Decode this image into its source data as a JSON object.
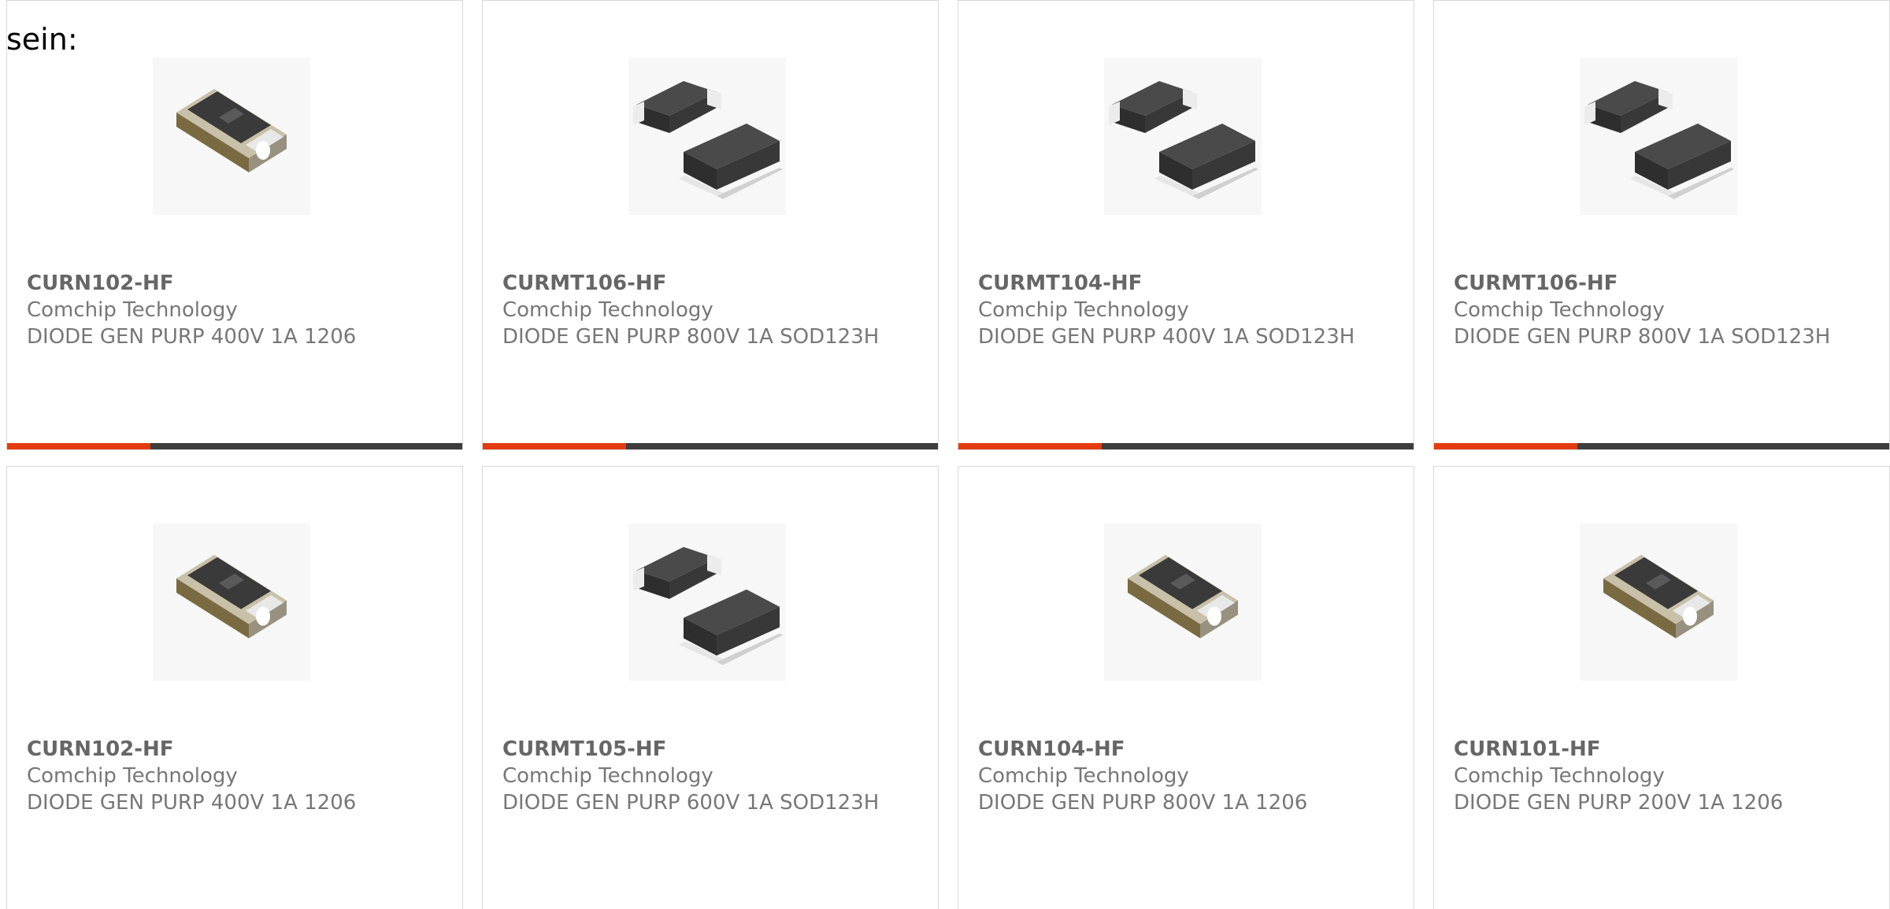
{
  "intro_text": "sein:",
  "colors": {
    "accent": "#e43b0f",
    "bar": "#3d3d3d",
    "border": "#d9d9d9",
    "text": "#777777"
  },
  "products": [
    {
      "part": "CURN102-HF",
      "maker": "Comchip Technology",
      "desc": "DIODE GEN PURP 400V 1A 1206",
      "icon": "diode-1206-package-icon"
    },
    {
      "part": "CURMT106-HF",
      "maker": "Comchip Technology",
      "desc": "DIODE GEN PURP 800V 1A SOD123H",
      "icon": "diode-sod123h-package-icon"
    },
    {
      "part": "CURMT104-HF",
      "maker": "Comchip Technology",
      "desc": "DIODE GEN PURP 400V 1A SOD123H",
      "icon": "diode-sod123h-package-icon"
    },
    {
      "part": "CURMT106-HF",
      "maker": "Comchip Technology",
      "desc": "DIODE GEN PURP 800V 1A SOD123H",
      "icon": "diode-sod123h-package-icon"
    },
    {
      "part": "CURN102-HF",
      "maker": "Comchip Technology",
      "desc": "DIODE GEN PURP 400V 1A 1206",
      "icon": "diode-1206-package-icon"
    },
    {
      "part": "CURMT105-HF",
      "maker": "Comchip Technology",
      "desc": "DIODE GEN PURP 600V 1A SOD123H",
      "icon": "diode-sod123h-package-icon"
    },
    {
      "part": "CURN104-HF",
      "maker": "Comchip Technology",
      "desc": "DIODE GEN PURP 800V 1A 1206",
      "icon": "diode-1206-package-icon"
    },
    {
      "part": "CURN101-HF",
      "maker": "Comchip Technology",
      "desc": "DIODE GEN PURP 200V 1A 1206",
      "icon": "diode-1206-package-icon"
    }
  ]
}
